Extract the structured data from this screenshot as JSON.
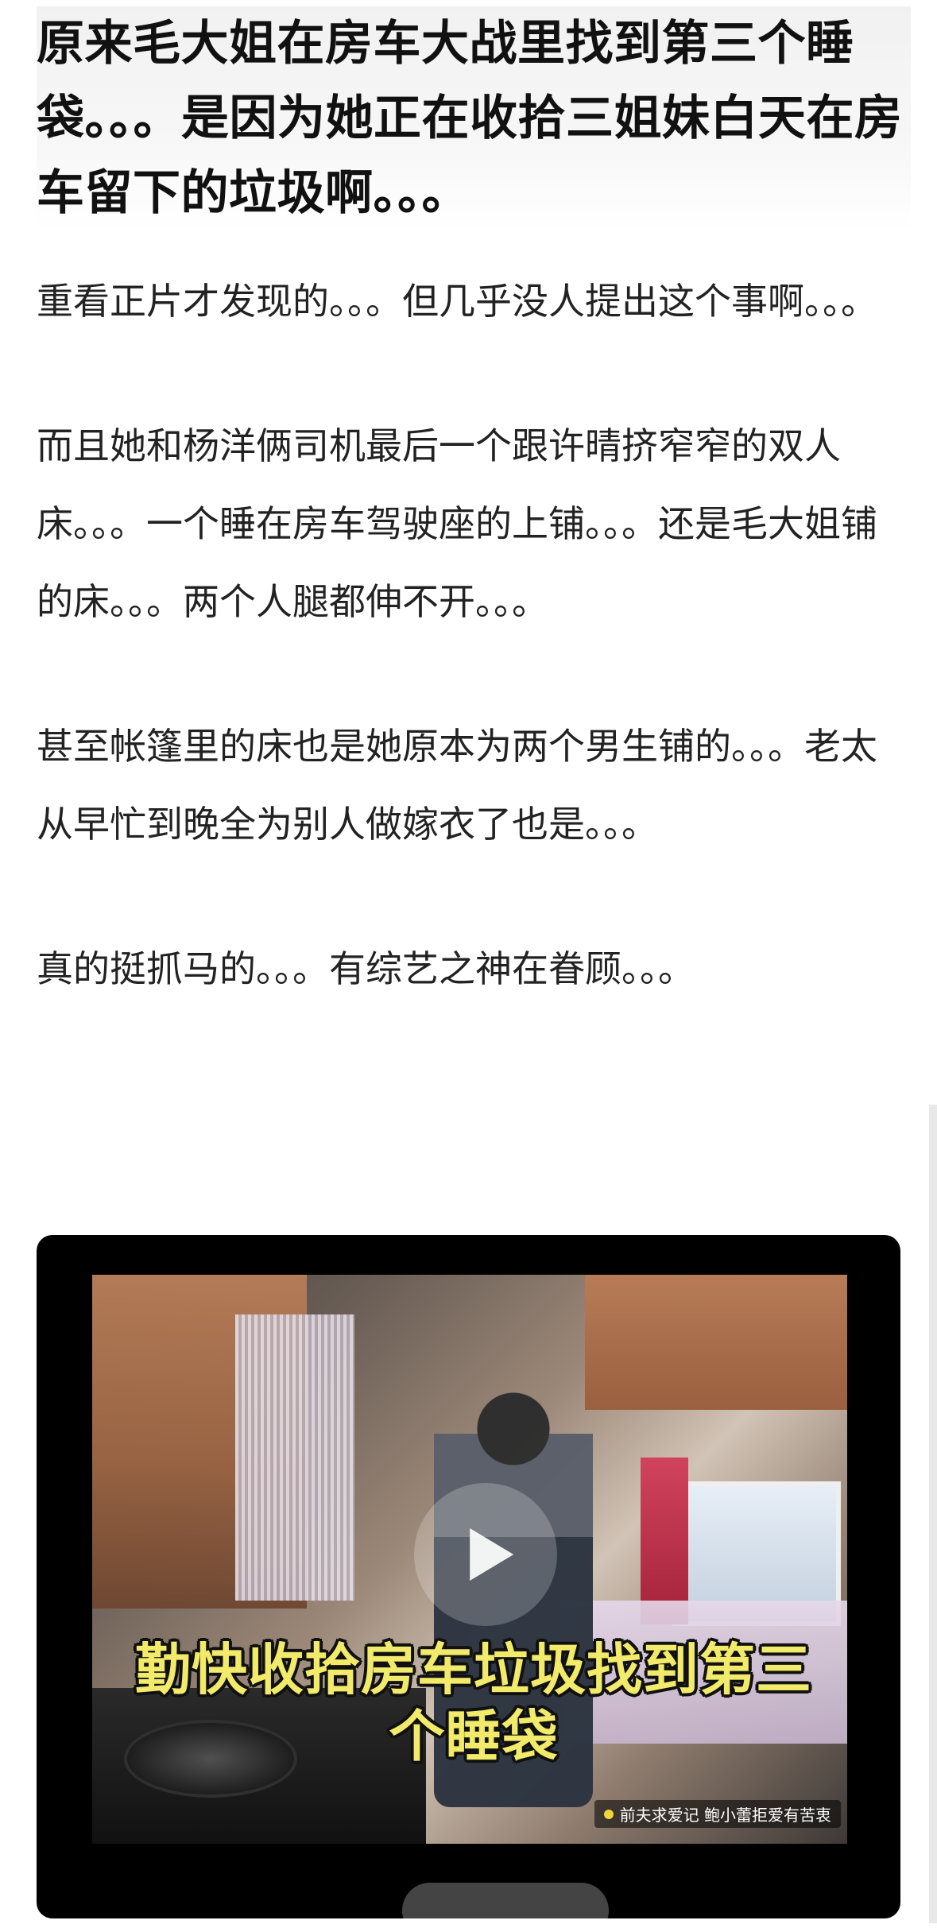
{
  "post": {
    "title": "原来毛大姐在房车大战里找到第三个睡袋。。。是因为她正在收拾三姐妹白天在房车留下的垃圾啊。。。",
    "paragraphs": [
      "重看正片才发现的。。。但几乎没人提出这个事啊。。。",
      "而且她和杨洋俩司机最后一个跟许晴挤窄窄的双人床。。。一个睡在房车驾驶座的上铺。。。还是毛大姐铺的床。。。两个人腿都伸不开。。。",
      "甚至帐篷里的床也是她原本为两个男生铺的。。。老太从早忙到晚全为别人做嫁衣了也是。。。",
      "真的挺抓马的。。。有综艺之神在眷顾。。。"
    ]
  },
  "video": {
    "caption": "勤快收拾房车垃圾找到第三个睡袋",
    "ticker": "前夫求爱记 鲍小蕾拒爱有苦衷",
    "play_icon": "play-icon"
  }
}
